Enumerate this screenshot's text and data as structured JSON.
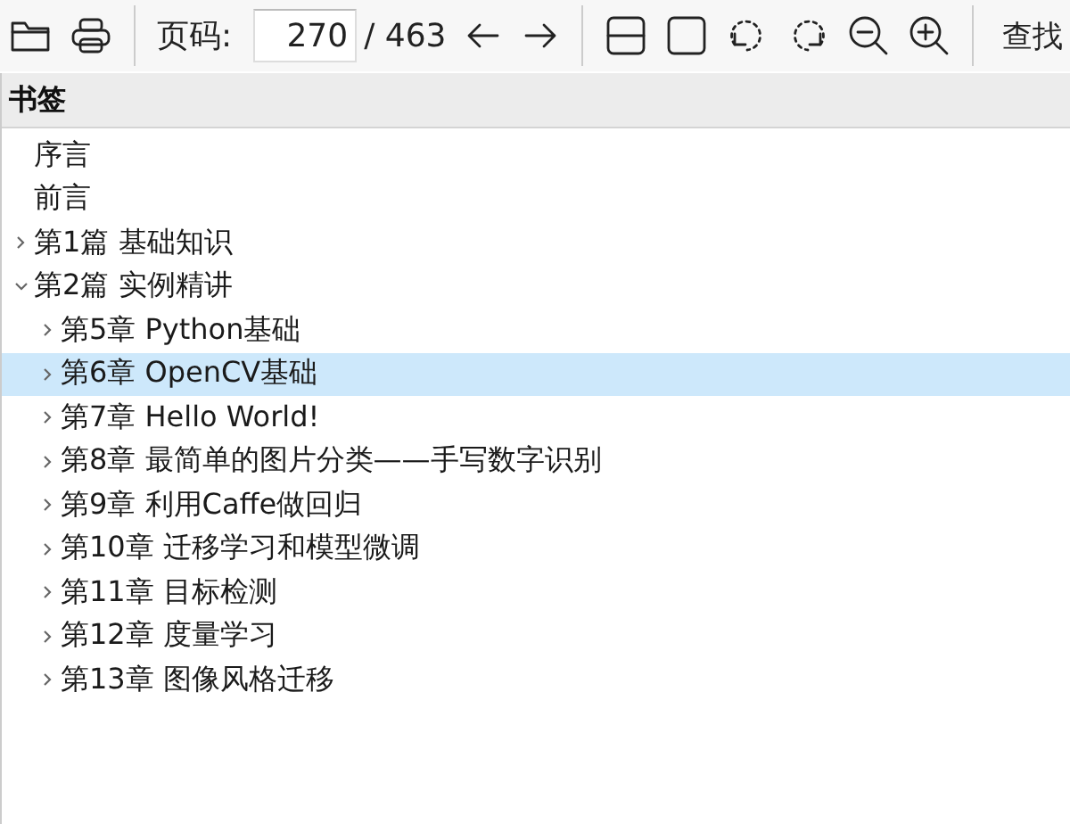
{
  "toolbar": {
    "page_label": "页码:",
    "page_value": "270",
    "page_total": "/ 463",
    "find_button": "查找"
  },
  "bookmarks": {
    "title": "书签",
    "items": [
      {
        "label": "序言",
        "selected": false
      },
      {
        "label": "前言",
        "selected": false
      },
      {
        "label": "第1篇 基础知识",
        "selected": false,
        "expanded": false
      },
      {
        "label": "第2篇 实例精讲",
        "selected": false,
        "expanded": true,
        "children": [
          {
            "label": "第5章 Python基础",
            "selected": false,
            "expanded": false
          },
          {
            "label": "第6章 OpenCV基础",
            "selected": true,
            "expanded": false
          },
          {
            "label": "第7章 Hello World!",
            "selected": false,
            "expanded": false
          },
          {
            "label": "第8章 最简单的图片分类——手写数字识别",
            "selected": false,
            "expanded": false
          },
          {
            "label": "第9章 利用Caffe做回归",
            "selected": false,
            "expanded": false
          },
          {
            "label": "第10章 迁移学习和模型微调",
            "selected": false,
            "expanded": false
          },
          {
            "label": "第11章 目标检测",
            "selected": false,
            "expanded": false
          },
          {
            "label": "第12章 度量学习",
            "selected": false,
            "expanded": false
          },
          {
            "label": "第13章 图像风格迁移",
            "selected": false,
            "expanded": false
          }
        ]
      }
    ]
  }
}
